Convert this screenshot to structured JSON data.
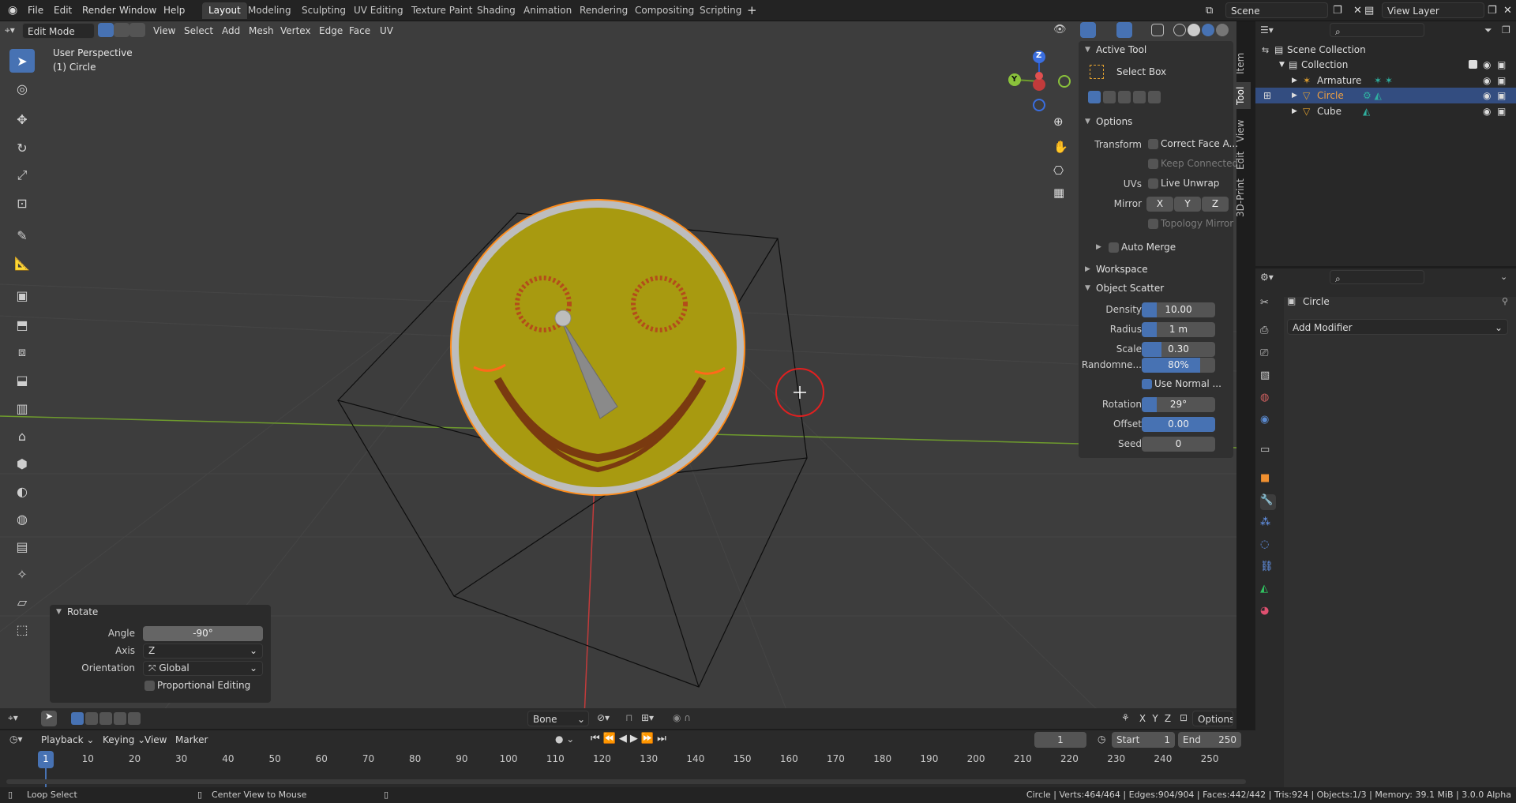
{
  "menu": [
    "File",
    "Edit",
    "Render",
    "Window",
    "Help"
  ],
  "workspaces": [
    "Layout",
    "Modeling",
    "Sculpting",
    "UV Editing",
    "Texture Paint",
    "Shading",
    "Animation",
    "Rendering",
    "Compositing",
    "Scripting"
  ],
  "active_workspace": "Layout",
  "scene_name": "Scene",
  "view_layer": "View Layer",
  "viewport_header": {
    "mode": "Edit Mode",
    "menus": [
      "View",
      "Select",
      "Add",
      "Mesh",
      "Vertex",
      "Edge",
      "Face",
      "UV"
    ]
  },
  "viewport_info": {
    "perspective": "User Perspective",
    "object": "(1) Circle"
  },
  "gizmo": {
    "z": "Z",
    "y": "Y"
  },
  "npanel": {
    "active_tool_header": "Active Tool",
    "tool_name": "Select Box",
    "options_header": "Options",
    "transform_label": "Transform",
    "correct_face": "Correct Face A...",
    "keep_connected": "Keep Connected",
    "uvs_label": "UVs",
    "live_unwrap": "Live Unwrap",
    "mirror_label": "Mirror",
    "mirror_axes": [
      "X",
      "Y",
      "Z"
    ],
    "topology_mirror": "Topology Mirror",
    "auto_merge": "Auto Merge",
    "workspace_header": "Workspace",
    "scatter_header": "Object Scatter",
    "density_label": "Density",
    "density": "10.00",
    "density_fill": 0.2,
    "radius_label": "Radius",
    "radius": "1 m",
    "radius_fill": 0.2,
    "scale_label": "Scale",
    "scale": "0.30",
    "scale_fill": 0.27,
    "random_label": "Randomne...",
    "random": "80%",
    "random_fill": 0.8,
    "use_normal": "Use Normal ...",
    "rotation_label": "Rotation",
    "rotation": "29°",
    "rotation_fill": 0.2,
    "offset_label": "Offset",
    "offset": "0.00",
    "offset_fill": 1.0,
    "seed_label": "Seed",
    "seed": "0"
  },
  "side_tabs": [
    "Item",
    "Tool",
    "View",
    "Edit",
    "3D-Print"
  ],
  "outliner": {
    "rows": [
      {
        "label": "Scene Collection"
      },
      {
        "label": "Collection"
      },
      {
        "label": "Armature"
      },
      {
        "label": "Circle"
      },
      {
        "label": "Cube"
      }
    ]
  },
  "properties": {
    "object_name": "Circle",
    "add_modifier": "Add Modifier"
  },
  "rotate_panel": {
    "title": "Rotate",
    "angle_label": "Angle",
    "angle": "-90°",
    "axis_label": "Axis",
    "axis": "Z",
    "orientation_label": "Orientation",
    "orientation": "Global",
    "proportional": "Proportional Editing"
  },
  "viewport_footer": {
    "bone": "Bone",
    "axes": [
      "X",
      "Y",
      "Z"
    ],
    "options": "Options"
  },
  "timeline": {
    "menus": [
      "Playback",
      "Keying",
      "View",
      "Marker"
    ],
    "current_frame": "1",
    "start_label": "Start",
    "start": "1",
    "end_label": "End",
    "end": "250",
    "ticks": [
      "1",
      "10",
      "20",
      "30",
      "40",
      "50",
      "60",
      "70",
      "80",
      "90",
      "100",
      "110",
      "120",
      "130",
      "140",
      "150",
      "160",
      "170",
      "180",
      "190",
      "200",
      "210",
      "220",
      "230",
      "240",
      "250"
    ]
  },
  "status": {
    "left1": "Loop Select",
    "left2": "Center View to Mouse",
    "right": "Circle | Verts:464/464 | Edges:904/904 | Faces:442/442 | Tris:924 | Objects:1/3 | Memory: 39.1 MiB | 3.0.0 Alpha"
  },
  "colors": {
    "accent": "#4772b3",
    "mesh_face": "#a89a10",
    "selected_edge": "#ff8c1a",
    "x_axis": "#c23b3b",
    "y_axis": "#6e9b2d"
  }
}
